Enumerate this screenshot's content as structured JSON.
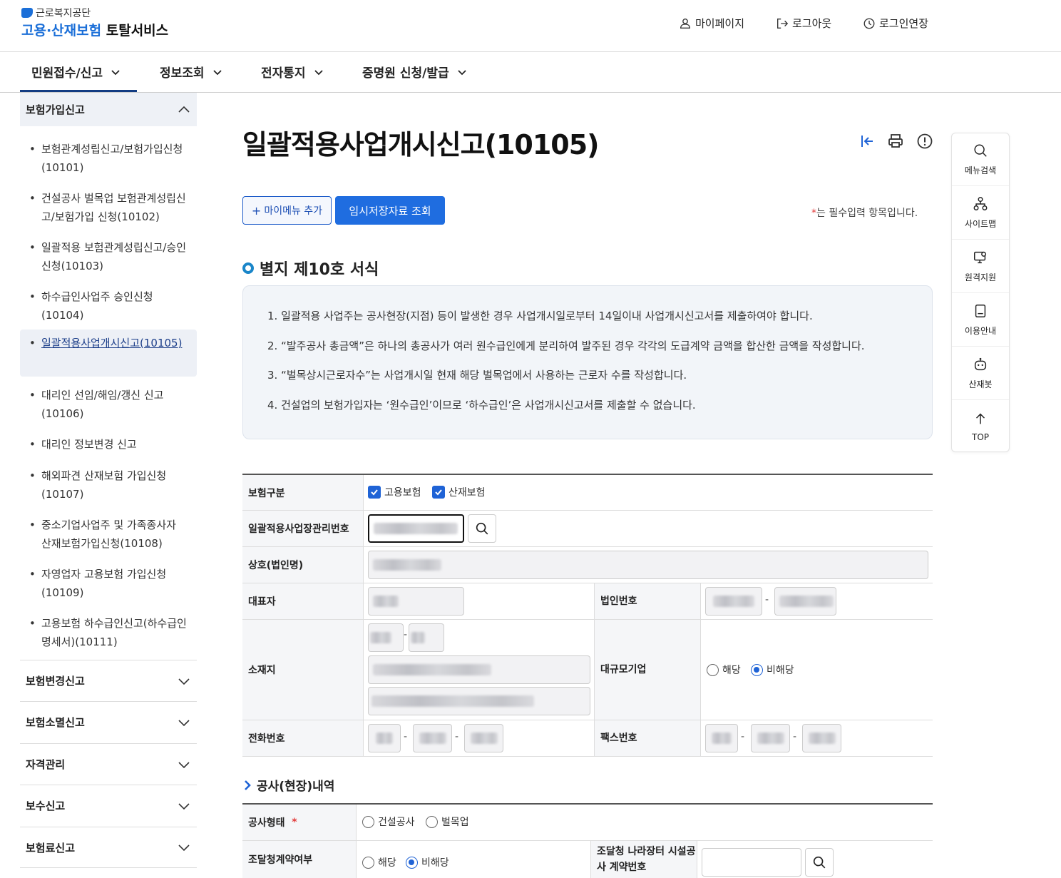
{
  "header": {
    "org_name": "근로복지공단",
    "service_title_blue": "고용·산재보험",
    "service_title_dark": "토탈서비스",
    "utils": [
      "마이페이지",
      "로그아웃",
      "로그인연장"
    ]
  },
  "gnb": [
    "민원접수/신고",
    "정보조회",
    "전자통지",
    "증명원 신청/발급"
  ],
  "lnb": {
    "open_section": "보험가입신고",
    "items": [
      "보험관계성립신고/보험가입신청(10101)",
      "건설공사 벌목업 보험관계성립신고/보험가입 신청(10102)",
      "일괄적용 보험관계성립신고/승인 신청(10103)",
      "하수급인사업주 승인신청(10104)",
      "일괄적용사업개시신고(10105)",
      "대리인 선임/해임/갱신 신고(10106)",
      "대리인 정보변경 신고",
      "해외파견 산재보험 가입신청(10107)",
      "중소기업사업주 및 가족종사자 산재보험가입신청(10108)",
      "자영업자 고용보험 가입신청(10109)",
      "고용보험 하수급인신고(하수급인 명세서)(10111)"
    ],
    "sections": [
      "보험변경신고",
      "보험소멸신고",
      "자격관리",
      "보수신고",
      "보험료신고"
    ]
  },
  "main": {
    "title": "일괄적용사업개시신고(10105)",
    "btn_mymenu": "마이메뉴 추가",
    "btn_temp": "임시저장자료 조회",
    "req_star": "*",
    "req_note": "는 필수입력 항목입니다.",
    "form_title": "별지 제10호 서식",
    "notices": [
      "1. 일괄적용 사업주는 공사현장(지점) 등이 발생한 경우 사업개시일로부터 14일이내 사업개시신고서를 제출하여야 합니다.",
      "2. “발주공사 총금액”은 하나의 총공사가 여러 원수급인에게 분리하여 발주된 경우 각각의 도급계약 금액을 합산한 금액을 작성합니다.",
      "3. “벌목상시근로자수”는 사업개시일 현재 해당 벌목업에서 사용하는 근로자 수를 작성합니다.",
      "4. 건설업의 보험가입자는 ‘원수급인’이므로 ‘하수급인’은 사업개시신고서를 제출할 수 없습니다."
    ],
    "form": {
      "insurance_type_label": "보험구분",
      "insurance_options": [
        "고용보험",
        "산재보험"
      ],
      "mgmt_no_label": "일괄적용사업장관리번호",
      "company_label": "상호(법인명)",
      "rep_label": "대표자",
      "corp_no_label": "법인번호",
      "address_label": "소재지",
      "large_corp_label": "대규모기업",
      "large_corp_options": [
        "해당",
        "비해당"
      ],
      "large_corp_selected": "비해당",
      "phone_label": "전화번호",
      "fax_label": "팩스번호",
      "dash": "-"
    },
    "section2_title": "공사(현장)내역",
    "form2": {
      "work_type_label": "공사형태",
      "required_star": "*",
      "work_type_options": [
        "건설공사",
        "벌목업"
      ],
      "procure_label": "조달청계약여부",
      "procure_options": [
        "해당",
        "비해당"
      ],
      "procure_selected": "비해당",
      "nara_label": "조달청 나라장터 시설공사 계약번호"
    }
  },
  "quick": [
    "메뉴검색",
    "사이트맵",
    "원격지원",
    "이용안내",
    "산재봇",
    "TOP"
  ],
  "colors": {
    "brand": "#1b6fd8",
    "primary_button": "#1f6de0",
    "gnb_active": "#123c82"
  }
}
